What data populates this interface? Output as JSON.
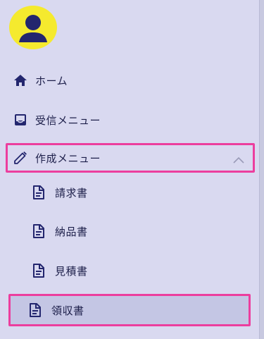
{
  "colors": {
    "accent_border": "#ec3e9e",
    "avatar_bg": "#f5ea2e",
    "avatar_fg": "#23266e",
    "sidebar_bg": "#d9d9f0",
    "selected_bg": "#c4c6e4",
    "text": "#1d1f4a"
  },
  "user": {
    "avatar_icon": "account-circle-icon"
  },
  "nav": {
    "home": {
      "label": "ホーム",
      "icon": "home-icon"
    },
    "inbox": {
      "label": "受信メニュー",
      "icon": "inbox-icon"
    },
    "create": {
      "label": "作成メニュー",
      "icon": "pencil-icon",
      "expanded": true,
      "toggle_icon": "chevron-up-icon"
    },
    "create_items": [
      {
        "label": "請求書",
        "icon": "document-icon"
      },
      {
        "label": "納品書",
        "icon": "document-icon"
      },
      {
        "label": "見積書",
        "icon": "document-icon"
      },
      {
        "label": "領収書",
        "icon": "document-icon",
        "selected": true
      }
    ]
  }
}
